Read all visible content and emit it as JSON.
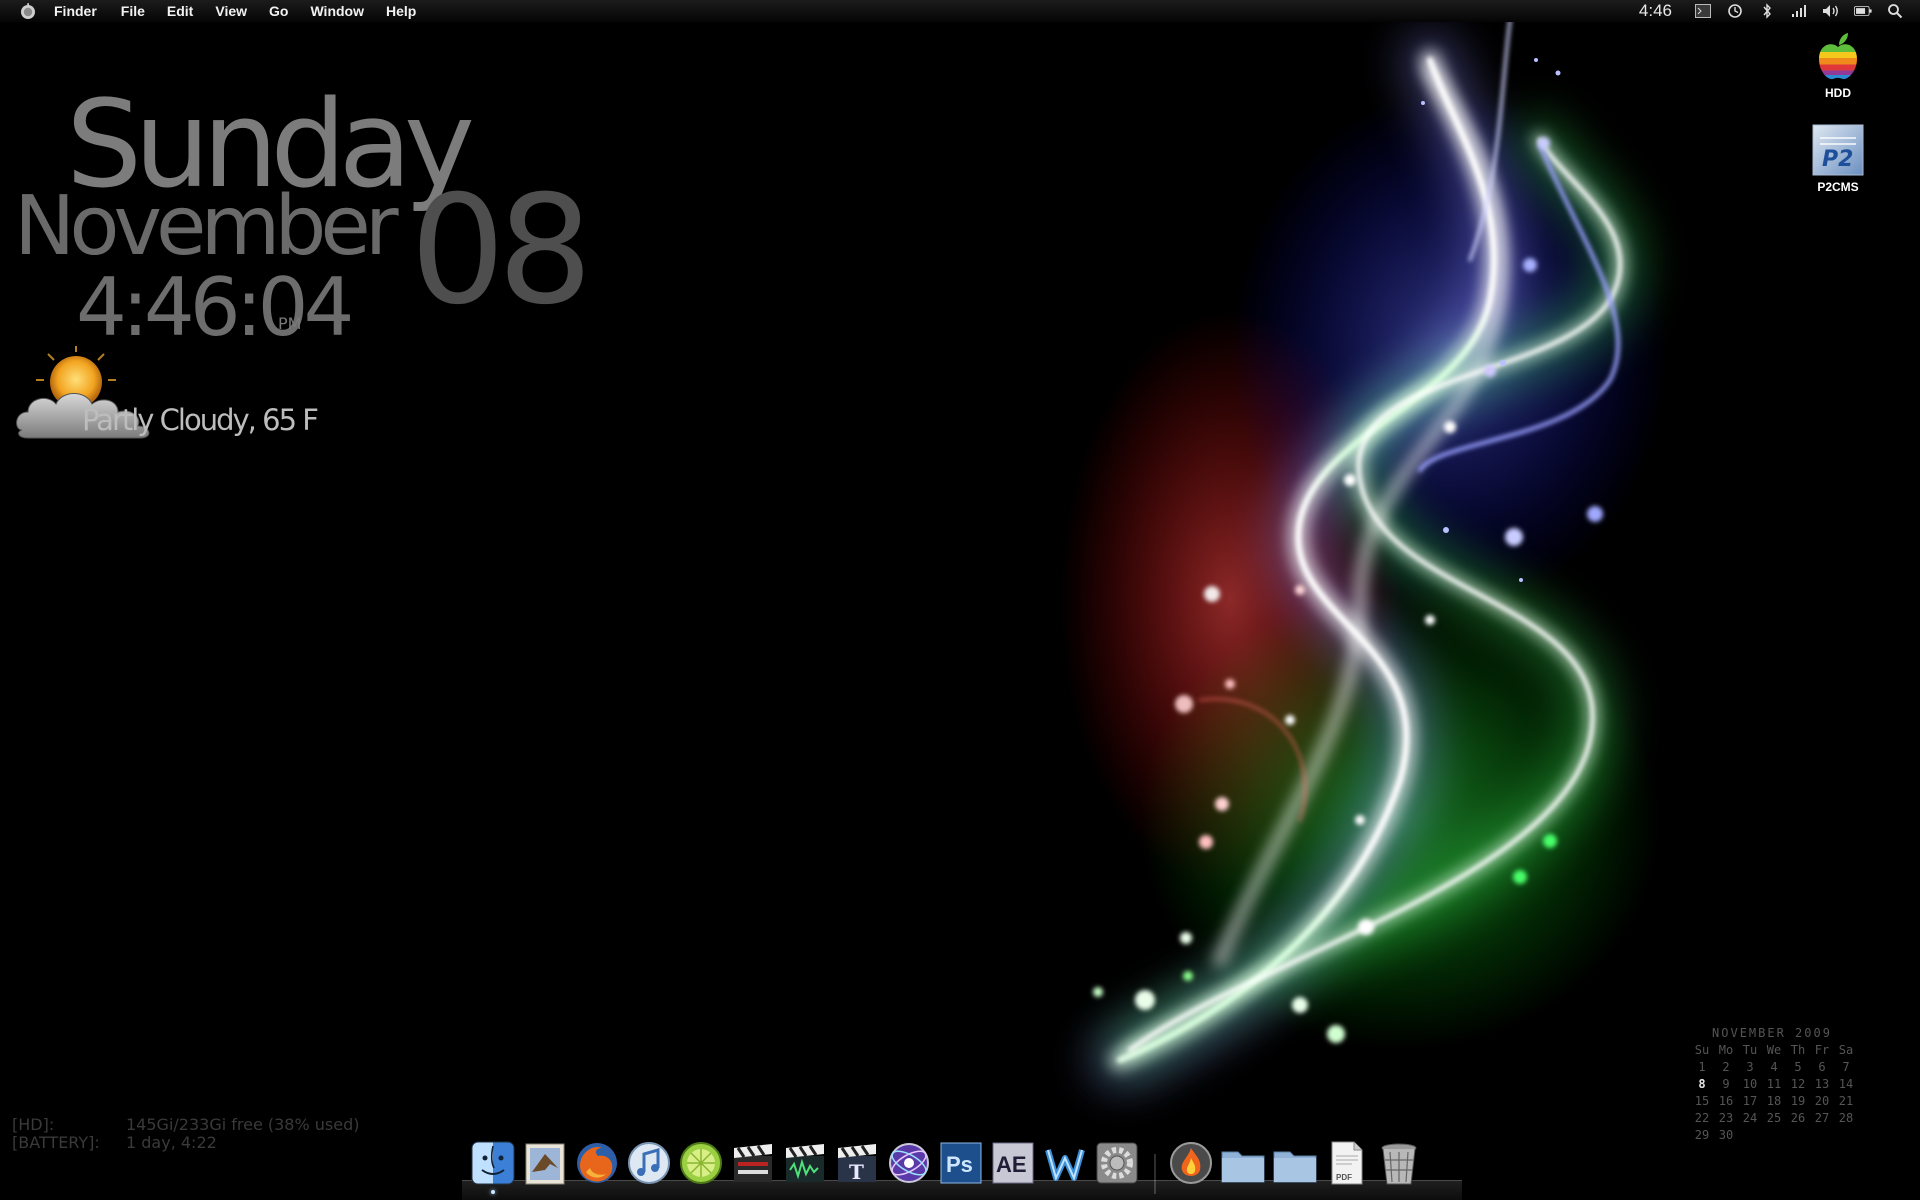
{
  "menubar": {
    "app_name": "Finder",
    "items": [
      "File",
      "Edit",
      "View",
      "Go",
      "Window",
      "Help"
    ],
    "clock": "4:46"
  },
  "desktop_icons": [
    {
      "label": "HDD",
      "icon": "apple-hdd-icon"
    },
    {
      "label": "P2CMS",
      "icon": "p2cms-icon"
    }
  ],
  "clock_widget": {
    "day": "Sunday",
    "month": "November",
    "date": "08",
    "time": "4:46:04",
    "ampm": "PM",
    "weather": "Partly Cloudy, 65 F"
  },
  "stats": {
    "hd_label": "[HD]:",
    "hd_value": "145Gi/233Gi free (38% used)",
    "battery_label": "[BATTERY]:",
    "battery_value": "1 day, 4:22"
  },
  "calendar": {
    "title": "NOVEMBER 2009",
    "weekdays": [
      "Su",
      "Mo",
      "Tu",
      "We",
      "Th",
      "Fr",
      "Sa"
    ],
    "weeks": [
      [
        "1",
        "2",
        "3",
        "4",
        "5",
        "6",
        "7"
      ],
      [
        "8",
        "9",
        "10",
        "11",
        "12",
        "13",
        "14"
      ],
      [
        "15",
        "16",
        "17",
        "18",
        "19",
        "20",
        "21"
      ],
      [
        "22",
        "23",
        "24",
        "25",
        "26",
        "27",
        "28"
      ],
      [
        "29",
        "30",
        "",
        "",
        "",
        "",
        ""
      ]
    ],
    "today": "8"
  },
  "dock": {
    "ps_label": "Ps",
    "ae_label": "AE",
    "pdf_label": "PDF",
    "apps": [
      "finder-icon",
      "mail-icon",
      "firefox-icon",
      "itunes-icon",
      "limewire-icon",
      "final-cut-icon",
      "soundtrack-icon",
      "motion-icon",
      "typography-icon",
      "dvd-studio-icon",
      "photoshop-icon",
      "after-effects-icon",
      "word-icon",
      "system-preferences-icon",
      "burn-icon",
      "applications-folder-icon",
      "documents-folder-icon",
      "pdf-document-icon",
      "trash-icon"
    ]
  },
  "colors": {
    "wallpaper": "#000000",
    "glow_white": "#ffffff",
    "glow_blue": "#6f78ff",
    "glow_red": "#ff3b3b",
    "glow_green": "#38ff5a"
  }
}
